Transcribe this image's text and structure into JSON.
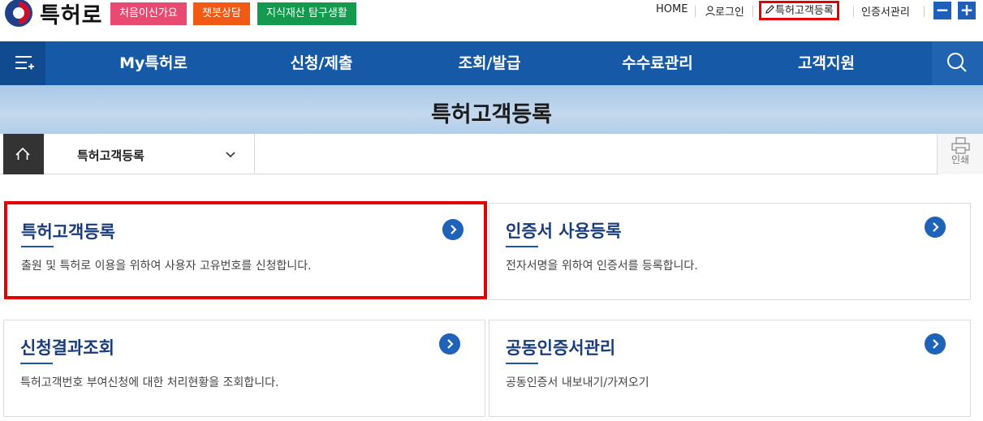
{
  "brand": {
    "name": "특허로"
  },
  "header_links": {
    "first_visit": "처음이신가요",
    "chatbot": "챗봇상담",
    "ip_explore": "지식재산 탐구생활",
    "home": "HOME",
    "login": "로그인",
    "register": "특허고객등록",
    "cert_manage": "인증서관리",
    "zoom_out": "−",
    "zoom_in": "+"
  },
  "colors": {
    "nav_bg": "#1659a6",
    "highlight": "#e40000",
    "title_blue": "#183d7a",
    "first_visit_pill": "#e84a72",
    "chatbot_pill": "#f25a14",
    "ip_pill": "#139a4f"
  },
  "nav": {
    "items": [
      "My특허로",
      "신청/제출",
      "조회/발급",
      "수수료관리",
      "고객지원"
    ],
    "menu_icon": "menu-icon",
    "search_icon": "search-icon"
  },
  "banner": {
    "title": "특허고객등록"
  },
  "breadcrumb": {
    "home_icon": "home-icon",
    "current": "특허고객등록",
    "print_label": "인쇄"
  },
  "cards": [
    {
      "title": "특허고객등록",
      "desc": "출원 및 특허로 이용을 위하여 사용자 고유번호를 신청합니다.",
      "highlighted": true
    },
    {
      "title": "인증서 사용등록",
      "desc": "전자서명을 위하여 인증서를 등록합니다.",
      "highlighted": false
    },
    {
      "title": "신청결과조회",
      "desc": "특허고객번호 부여신청에 대한 처리현황을 조회합니다.",
      "highlighted": false
    },
    {
      "title": "공동인증서관리",
      "desc": "공동인증서 내보내기/가져오기",
      "highlighted": false
    }
  ]
}
